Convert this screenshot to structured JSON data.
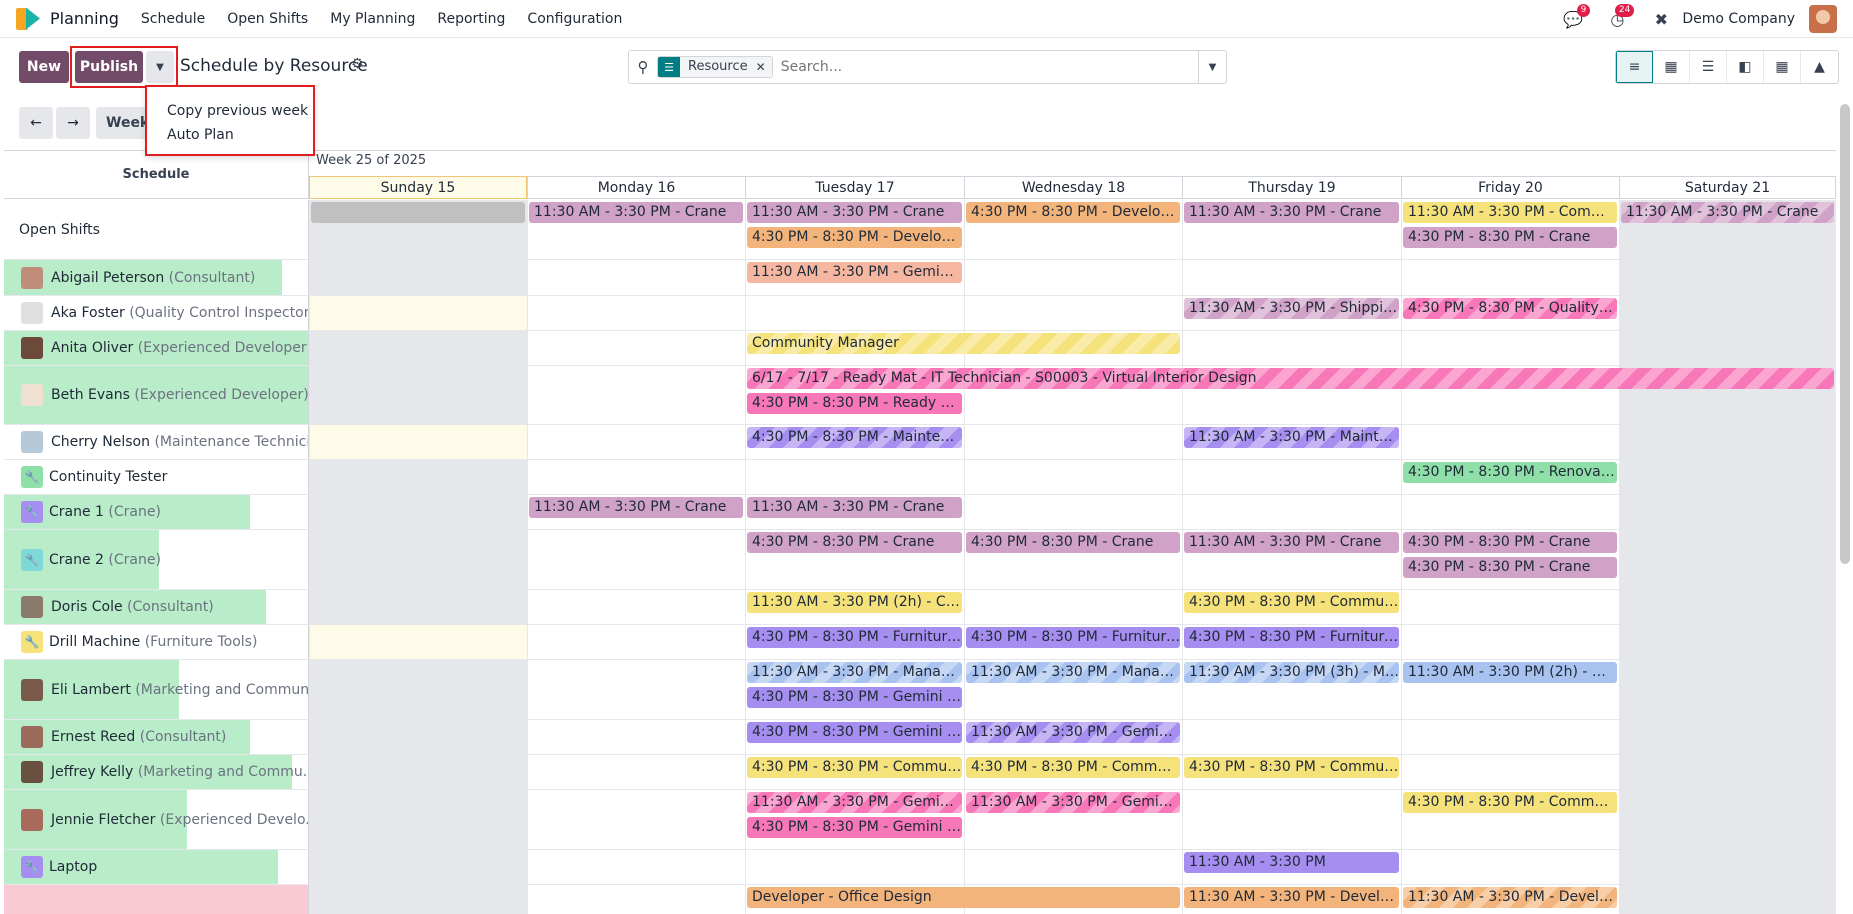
{
  "nav": {
    "app_name": "Planning",
    "items": [
      "Schedule",
      "Open Shifts",
      "My Planning",
      "Reporting",
      "Configuration"
    ],
    "messages_badge": "9",
    "activity_badge": "24",
    "company": "Demo Company"
  },
  "cpanel": {
    "new_label": "New",
    "publish_label": "Publish",
    "view_title": "Schedule by Resource",
    "search_facet": "Resource",
    "search_placeholder": "Search..."
  },
  "dropdown": {
    "items": [
      "Copy previous week",
      "Auto Plan"
    ]
  },
  "datenav": {
    "week_label": "Week"
  },
  "gantt": {
    "week_title": "Week 25 of 2025",
    "schedule_header": "Schedule",
    "days": [
      "Sunday 15",
      "Monday 16",
      "Tuesday 17",
      "Wednesday 18",
      "Thursday 19",
      "Friday 20",
      "Saturday 21"
    ],
    "rows": [
      {
        "name": "Open Shifts",
        "job": ""
      },
      {
        "name": "Abigail Peterson",
        "job": "(Consultant)"
      },
      {
        "name": "Aka Foster",
        "job": "(Quality Control Inspector)"
      },
      {
        "name": "Anita Oliver",
        "job": "(Experienced Developer)"
      },
      {
        "name": "Beth Evans",
        "job": "(Experienced Developer)"
      },
      {
        "name": "Cherry Nelson",
        "job": "(Maintenance Technici..."
      },
      {
        "name": "Continuity Tester",
        "job": ""
      },
      {
        "name": "Crane 1",
        "job": "(Crane)"
      },
      {
        "name": "Crane 2",
        "job": "(Crane)"
      },
      {
        "name": "Doris Cole",
        "job": "(Consultant)"
      },
      {
        "name": "Drill Machine",
        "job": "(Furniture Tools)"
      },
      {
        "name": "Eli Lambert",
        "job": "(Marketing and Communi..."
      },
      {
        "name": "Ernest Reed",
        "job": "(Consultant)"
      },
      {
        "name": "Jeffrey Kelly",
        "job": "(Marketing and Commu..."
      },
      {
        "name": "Jennie Fletcher",
        "job": "(Experienced Develo..."
      },
      {
        "name": "Laptop",
        "job": ""
      },
      {
        "name": "",
        "job": ""
      }
    ],
    "pills": {
      "r0_mon": "11:30 AM - 3:30 PM - Crane",
      "r0_tue1": "11:30 AM - 3:30 PM - Crane",
      "r0_tue2": "4:30 PM - 8:30 PM - Developer ...",
      "r0_wed": "4:30 PM - 8:30 PM - Developer ...",
      "r0_thu": "11:30 AM - 3:30 PM - Crane",
      "r0_fri1": "11:30 AM - 3:30 PM - Communi...",
      "r0_fri2": "4:30 PM - 8:30 PM - Crane",
      "r0_sat": "11:30 AM - 3:30 PM - Crane",
      "r1_tue": "11:30 AM - 3:30 PM - Gemini F...",
      "r2_thu": "11:30 AM - 3:30 PM - Shipping ...",
      "r2_fri": "4:30 PM - 8:30 PM - Quality Co...",
      "r3_tue": "Community Manager",
      "r4_tue1": "6/17 - 7/17 - Ready Mat - IT Technician - S00003 - Virtual Interior Design",
      "r4_tue2": "4:30 PM - 8:30 PM - Ready Mat ...",
      "r5_tue": "4:30 PM - 8:30 PM - Maintenan...",
      "r5_thu": "11:30 AM - 3:30 PM - Maintena...",
      "r6_fri": "4:30 PM - 8:30 PM - Renovations",
      "r7_mon": "11:30 AM - 3:30 PM - Crane",
      "r7_tue": "11:30 AM - 3:30 PM - Crane",
      "r8_tue": "4:30 PM - 8:30 PM - Crane",
      "r8_wed": "4:30 PM - 8:30 PM - Crane",
      "r8_thu": "11:30 AM - 3:30 PM - Crane",
      "r8_fri1": "4:30 PM - 8:30 PM - Crane",
      "r8_fri2": "4:30 PM - 8:30 PM - Crane",
      "r9_tue": "11:30 AM - 3:30 PM (2h) - Com...",
      "r9_thu": "4:30 PM - 8:30 PM - Communit...",
      "r10_tue": "4:30 PM - 8:30 PM - Furniture T...",
      "r10_wed": "4:30 PM - 8:30 PM - Furniture T...",
      "r10_thu": "4:30 PM - 8:30 PM - Furniture T...",
      "r11_tue1": "11:30 AM - 3:30 PM - Manage...",
      "r11_tue2": "4:30 PM - 8:30 PM - Gemini Fur...",
      "r11_wed": "11:30 AM - 3:30 PM - Manage...",
      "r11_thu": "11:30 AM - 3:30 PM (3h) - Man...",
      "r11_fri": "11:30 AM - 3:30 PM (2h) - Man...",
      "r12_tue": "4:30 PM - 8:30 PM - Gemini Fur...",
      "r12_wed": "11:30 AM - 3:30 PM - Gemini F...",
      "r13_tue": "4:30 PM - 8:30 PM - Communit...",
      "r13_wed": "4:30 PM - 8:30 PM - Communit...",
      "r13_thu": "4:30 PM - 8:30 PM - Communit...",
      "r14_tue1": "11:30 AM - 3:30 PM - Gemini F...",
      "r14_tue2": "4:30 PM - 8:30 PM - Gemini Fur...",
      "r14_wed": "11:30 AM - 3:30 PM - Gemini F...",
      "r14_fri": "4:30 PM - 8:30 PM - Communit...",
      "r15_thu": "11:30 AM - 3:30 PM",
      "r16_tue": "Developer - Office Design",
      "r16_thu": "11:30 AM - 3:30 PM - Developer",
      "r16_fri": "11:30 AM - 3:30 PM - Develope..."
    }
  }
}
